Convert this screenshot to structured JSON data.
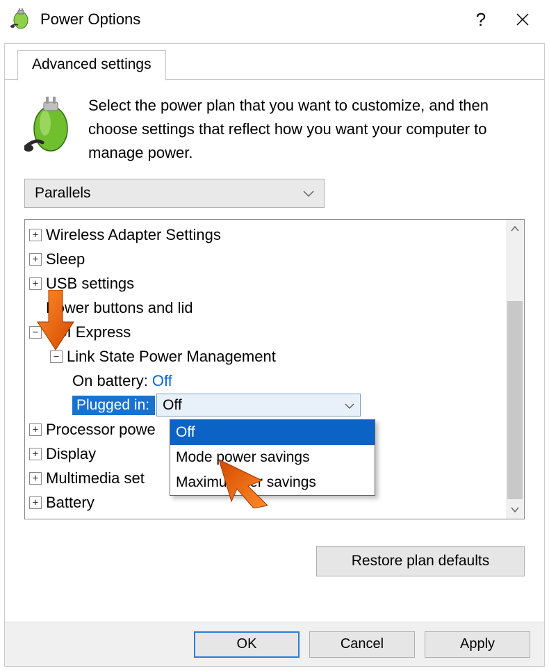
{
  "window": {
    "title": "Power Options",
    "help_tooltip": "?",
    "close_tooltip": "Close"
  },
  "tab": {
    "label": "Advanced settings"
  },
  "intro": "Select the power plan that you want to customize, and then choose settings that reflect how you want your computer to manage power.",
  "plan_dropdown": {
    "selected": "Parallels"
  },
  "tree": {
    "wireless": "Wireless Adapter Settings",
    "sleep": "Sleep",
    "usb": "USB settings",
    "powerbtns": "Power buttons and lid",
    "pci": "PCI Express",
    "link_state": "Link State Power Management",
    "on_battery_label": "On battery:",
    "on_battery_value": "Off",
    "plugged_in_label": "Plugged in:",
    "plugged_in_value": "Off",
    "processor": "Processor powe",
    "display": "Display",
    "multimedia": "Multimedia set",
    "battery": "Battery"
  },
  "dropdown_options": {
    "opt0": "Off",
    "opt1": "Mode       power savings",
    "opt2": "Maximu      ower savings"
  },
  "buttons": {
    "restore": "Restore plan defaults",
    "ok": "OK",
    "cancel": "Cancel",
    "apply": "Apply"
  }
}
